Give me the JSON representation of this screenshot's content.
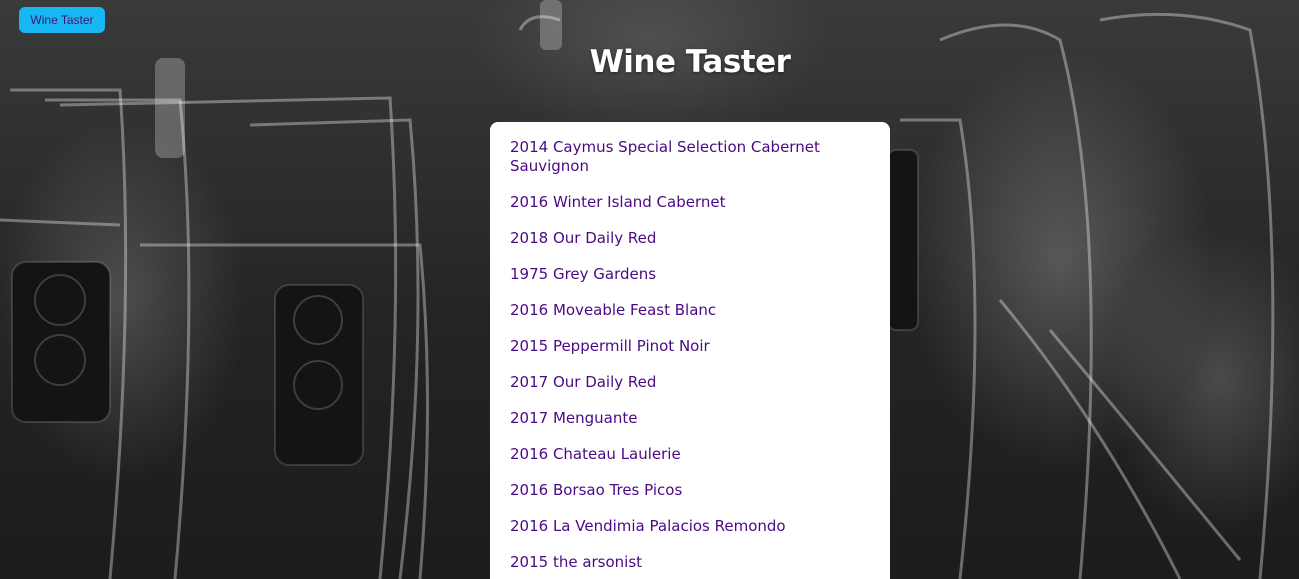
{
  "nav": {
    "brand_label": "Wine Taster"
  },
  "header": {
    "title": "Wine Taster"
  },
  "wines": [
    "2014 Caymus Special Selection Cabernet Sauvignon",
    "2016 Winter Island Cabernet",
    "2018 Our Daily Red",
    "1975 Grey Gardens",
    "2016 Moveable Feast Blanc",
    "2015 Peppermill Pinot Noir",
    "2017 Our Daily Red",
    "2017 Menguante",
    "2016 Chateau Laulerie",
    "2016 Borsao Tres Picos",
    "2016 La Vendimia Palacios Remondo",
    "2015 the arsonist"
  ],
  "colors": {
    "brand_button": "#19b6f6",
    "link": "#4b0a84",
    "card": "#ffffff"
  },
  "background": {
    "image": "photo-of-wine-glasses"
  }
}
